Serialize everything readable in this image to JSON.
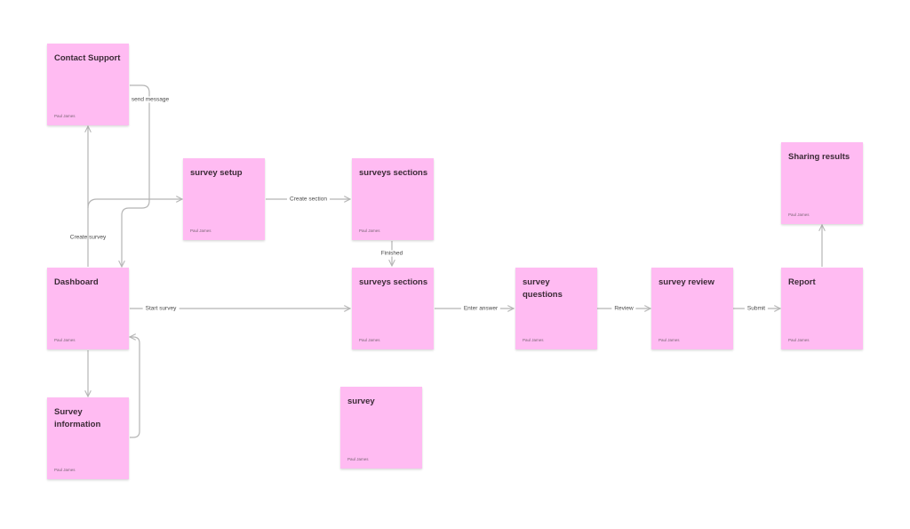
{
  "diagram": {
    "author": "Paul James",
    "sticky_color": "#ffbbf2",
    "nodes": [
      {
        "id": "contact-support",
        "title": "Contact Support"
      },
      {
        "id": "survey-setup",
        "title": "survey setup"
      },
      {
        "id": "surveys-sections-top",
        "title": "surveys sections"
      },
      {
        "id": "sharing-results",
        "title": "Sharing results"
      },
      {
        "id": "dashboard",
        "title": "Dashboard"
      },
      {
        "id": "surveys-sections",
        "title": "surveys sections"
      },
      {
        "id": "survey-questions",
        "title": "survey questions"
      },
      {
        "id": "survey-review",
        "title": "survey review"
      },
      {
        "id": "report",
        "title": "Report"
      },
      {
        "id": "survey-information",
        "title": "Survey information"
      },
      {
        "id": "survey",
        "title": "survey"
      }
    ],
    "edges": [
      {
        "from": "contact-support",
        "to": "dashboard",
        "label": "send message"
      },
      {
        "from": "dashboard",
        "to": "contact-support",
        "label": ""
      },
      {
        "from": "dashboard",
        "to": "survey-setup",
        "label": "Create survey"
      },
      {
        "from": "survey-setup",
        "to": "surveys-sections-top",
        "label": "Create section"
      },
      {
        "from": "surveys-sections-top",
        "to": "surveys-sections",
        "label": "Finished"
      },
      {
        "from": "dashboard",
        "to": "surveys-sections",
        "label": "Start survey"
      },
      {
        "from": "surveys-sections",
        "to": "survey-questions",
        "label": "Enter answer"
      },
      {
        "from": "survey-questions",
        "to": "survey-review",
        "label": "Review"
      },
      {
        "from": "survey-review",
        "to": "report",
        "label": "Submit"
      },
      {
        "from": "report",
        "to": "sharing-results",
        "label": ""
      },
      {
        "from": "dashboard",
        "to": "survey-information",
        "label": ""
      },
      {
        "from": "survey-information",
        "to": "dashboard",
        "label": ""
      }
    ]
  }
}
